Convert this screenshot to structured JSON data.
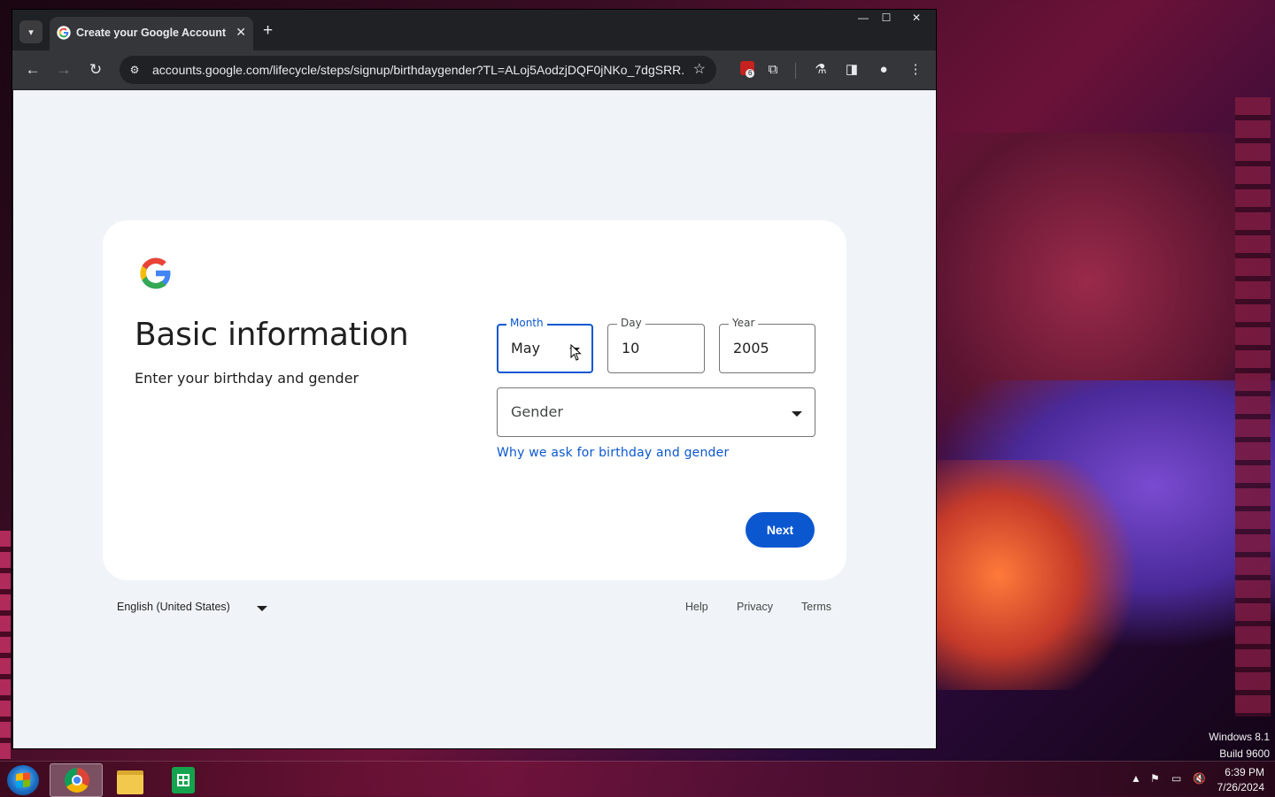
{
  "os": {
    "edition": "Windows 8.1",
    "build": "Build 9600",
    "clock_time": "6:39 PM",
    "clock_date": "7/26/2024"
  },
  "browser": {
    "tab_title": "Create your Google Account",
    "url": "accounts.google.com/lifecycle/steps/signup/birthdaygender?TL=ALoj5AodzjDQF0jNKo_7dgSRR...",
    "extension_badge": "6",
    "icons": {
      "tab_list": "chevron-down-icon",
      "close_tab": "close-icon",
      "new_tab": "plus-icon",
      "back": "arrow-left-icon",
      "forward": "arrow-right-icon",
      "reload": "reload-icon",
      "site_info": "tune-icon",
      "bookmark": "star-icon",
      "extensions": "puzzle-icon",
      "labs": "flask-icon",
      "side_panel": "side-panel-icon",
      "profile": "profile-icon",
      "menu": "kebab-menu-icon"
    }
  },
  "signup": {
    "heading": "Basic information",
    "subheading": "Enter your birthday and gender",
    "month": {
      "label": "Month",
      "value": "May"
    },
    "day": {
      "label": "Day",
      "value": "10"
    },
    "year": {
      "label": "Year",
      "value": "2005"
    },
    "gender": {
      "placeholder": "Gender"
    },
    "why_link": "Why we ask for birthday and gender",
    "next_label": "Next",
    "brand_colors": {
      "blue": "#4285F4",
      "red": "#EA4335",
      "yellow": "#FBBC05",
      "green": "#34A853",
      "accent": "#0b57d0"
    }
  },
  "footer": {
    "language": "English (United States)",
    "help": "Help",
    "privacy": "Privacy",
    "terms": "Terms"
  }
}
